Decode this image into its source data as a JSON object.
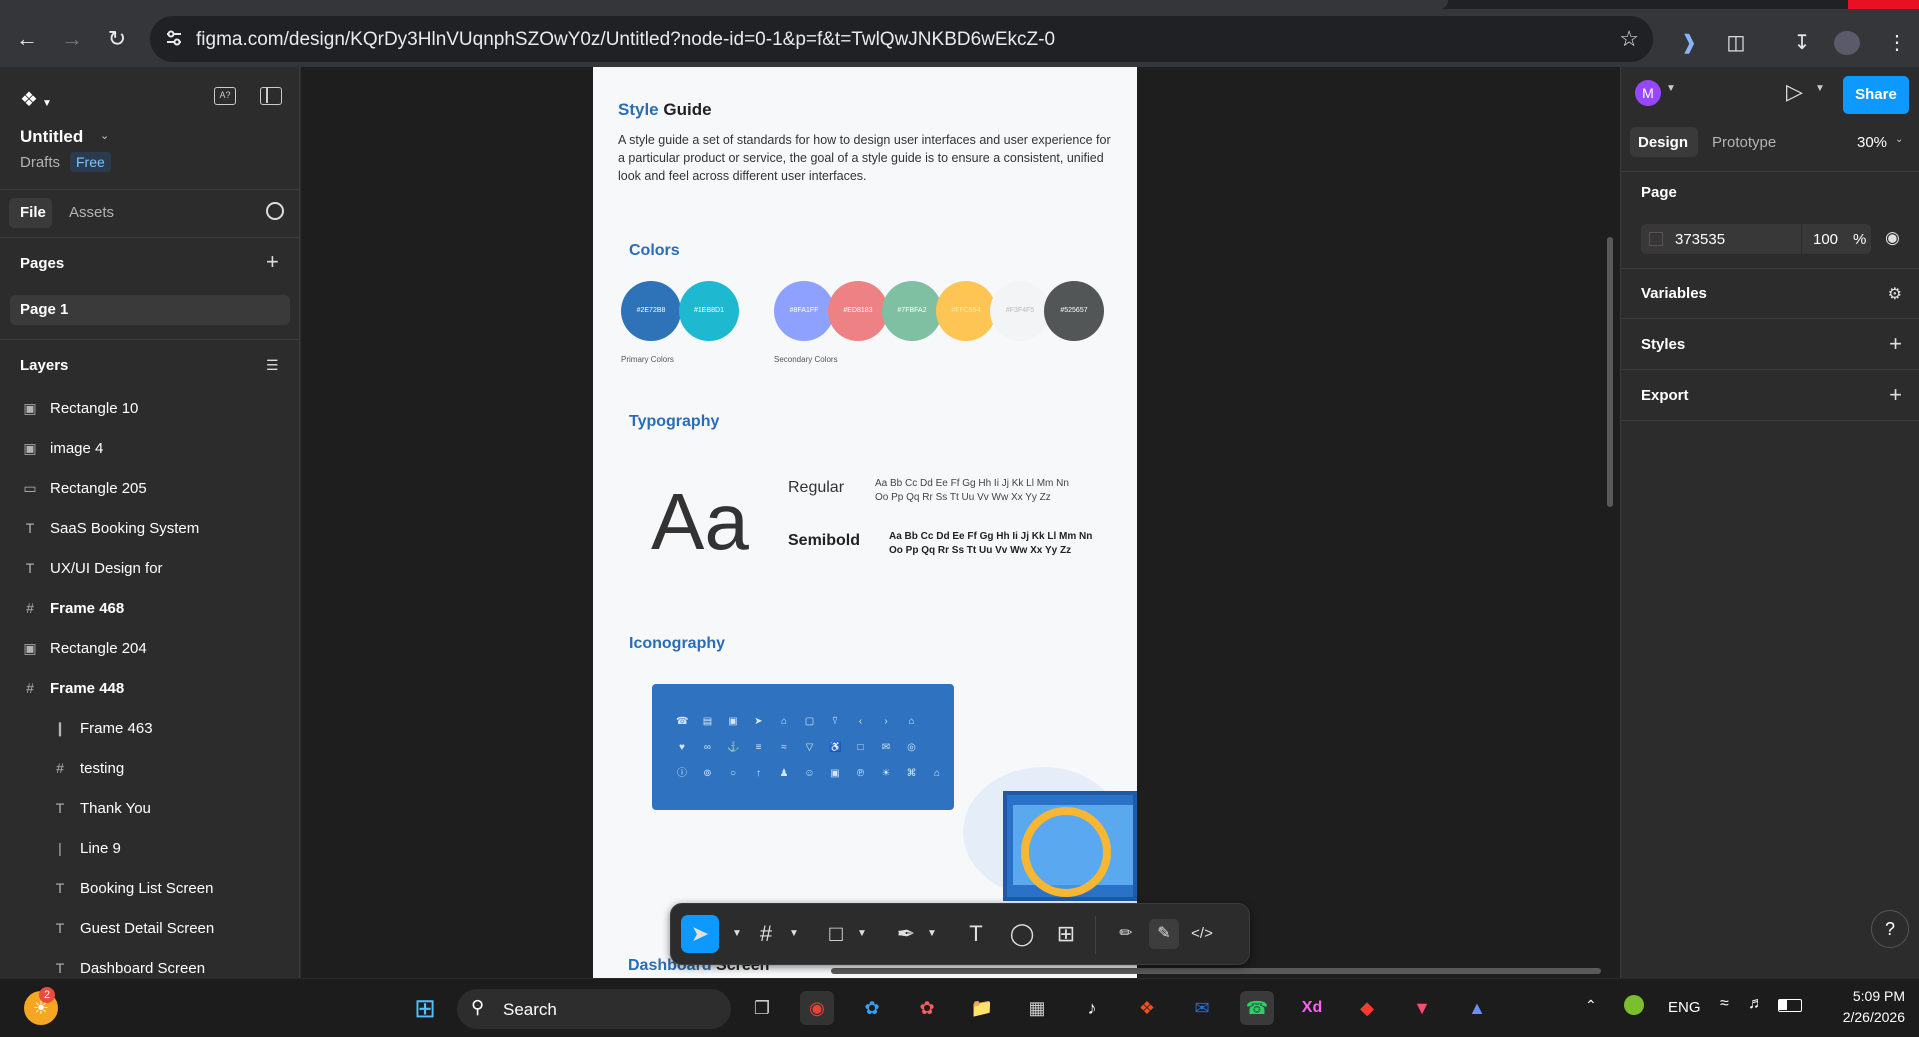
{
  "browser": {
    "url": "figma.com/design/KQrDy3HlnVUqnphSZOwY0z/Untitled?node-id=0-1&p=f&t=TwlQwJNKBD6wEkcZ-0"
  },
  "file": {
    "name": "Untitled",
    "location": "Drafts",
    "plan_badge": "Free"
  },
  "left_tabs": {
    "file": "File",
    "assets": "Assets"
  },
  "pages": {
    "heading": "Pages",
    "items": [
      "Page 1"
    ]
  },
  "layers": {
    "heading": "Layers",
    "items": [
      {
        "label": "Rectangle 10",
        "icon": "image-icon",
        "indent": 0
      },
      {
        "label": "image 4",
        "icon": "image-icon",
        "indent": 0
      },
      {
        "label": "Rectangle 205",
        "icon": "rectangle-icon",
        "indent": 0
      },
      {
        "label": "SaaS Booking System",
        "icon": "text-icon",
        "indent": 0
      },
      {
        "label": "UX/UI Design for",
        "icon": "text-icon",
        "indent": 0
      },
      {
        "label": "Frame 468",
        "icon": "frame-icon",
        "indent": 0
      },
      {
        "label": "Rectangle 204",
        "icon": "image-icon",
        "indent": 0
      },
      {
        "label": "Frame 448",
        "icon": "frame-icon",
        "indent": 0
      },
      {
        "label": "Frame 463",
        "icon": "autolayout-icon",
        "indent": 1
      },
      {
        "label": "testing",
        "icon": "frame-icon",
        "indent": 1
      },
      {
        "label": "Thank You",
        "icon": "text-icon",
        "indent": 1
      },
      {
        "label": "Line 9",
        "icon": "line-icon",
        "indent": 1
      },
      {
        "label": "Booking List Screen",
        "icon": "text-icon",
        "indent": 1
      },
      {
        "label": "Guest Detail Screen",
        "icon": "text-icon",
        "indent": 1
      },
      {
        "label": "Dashboard Screen",
        "icon": "text-icon",
        "indent": 1
      }
    ]
  },
  "style_guide": {
    "title_accent": "Style",
    "title_rest": "Guide",
    "description": "A style guide a set of standards for how to design user interfaces and user experience for a particular product or service, the goal of a style guide is to ensure a consistent, unified look and feel across different user interfaces.",
    "colors_heading": "Colors",
    "primary_label": "Primary Colors",
    "secondary_label": "Secondary Colors",
    "primary": [
      {
        "hex": "#2E72B8",
        "color": "#2e72b8"
      },
      {
        "hex": "#1EB8D1",
        "color": "#1eb8d1"
      }
    ],
    "secondary": [
      {
        "hex": "#8FA1FF",
        "color": "#8fa1ff"
      },
      {
        "hex": "#ED8183",
        "color": "#ed8183"
      },
      {
        "hex": "#7FBFA2",
        "color": "#7fbfa2"
      },
      {
        "hex": "#FFC554",
        "color": "#ffc554"
      },
      {
        "hex": "#F3F4F5",
        "color": "#f3f4f5"
      },
      {
        "hex": "#525657",
        "color": "#525657"
      }
    ],
    "typography_heading": "Typography",
    "sample_glyph": "Aa",
    "regular_label": "Regular",
    "semibold_label": "Semibold",
    "alphabet_line1": "Aa Bb Cc Dd Ee Ff Gg Hh Ii Jj Kk Ll Mm Nn",
    "alphabet_line2": "Oo Pp Qq Rr Ss Tt Uu Vv Ww Xx Yy Zz",
    "iconography_heading": "Iconography",
    "next_heading_accent": "Dashboard",
    "next_heading_rest": "Screen"
  },
  "right_panel": {
    "avatar_letter": "M",
    "share_label": "Share",
    "tab_design": "Design",
    "tab_prototype": "Prototype",
    "zoom": "30%",
    "page_heading": "Page",
    "page_color": "373535",
    "page_opacity": "100",
    "percent_sign": "%",
    "variables": "Variables",
    "styles": "Styles",
    "export": "Export",
    "help": "?"
  },
  "taskbar": {
    "search_placeholder": "Search",
    "notification_count": "2",
    "language": "ENG",
    "time": "5:09 PM",
    "date": "2/26/2026"
  },
  "colors": {
    "figma_blue": "#0d99ff",
    "accent_blue": "#2a6db6"
  }
}
